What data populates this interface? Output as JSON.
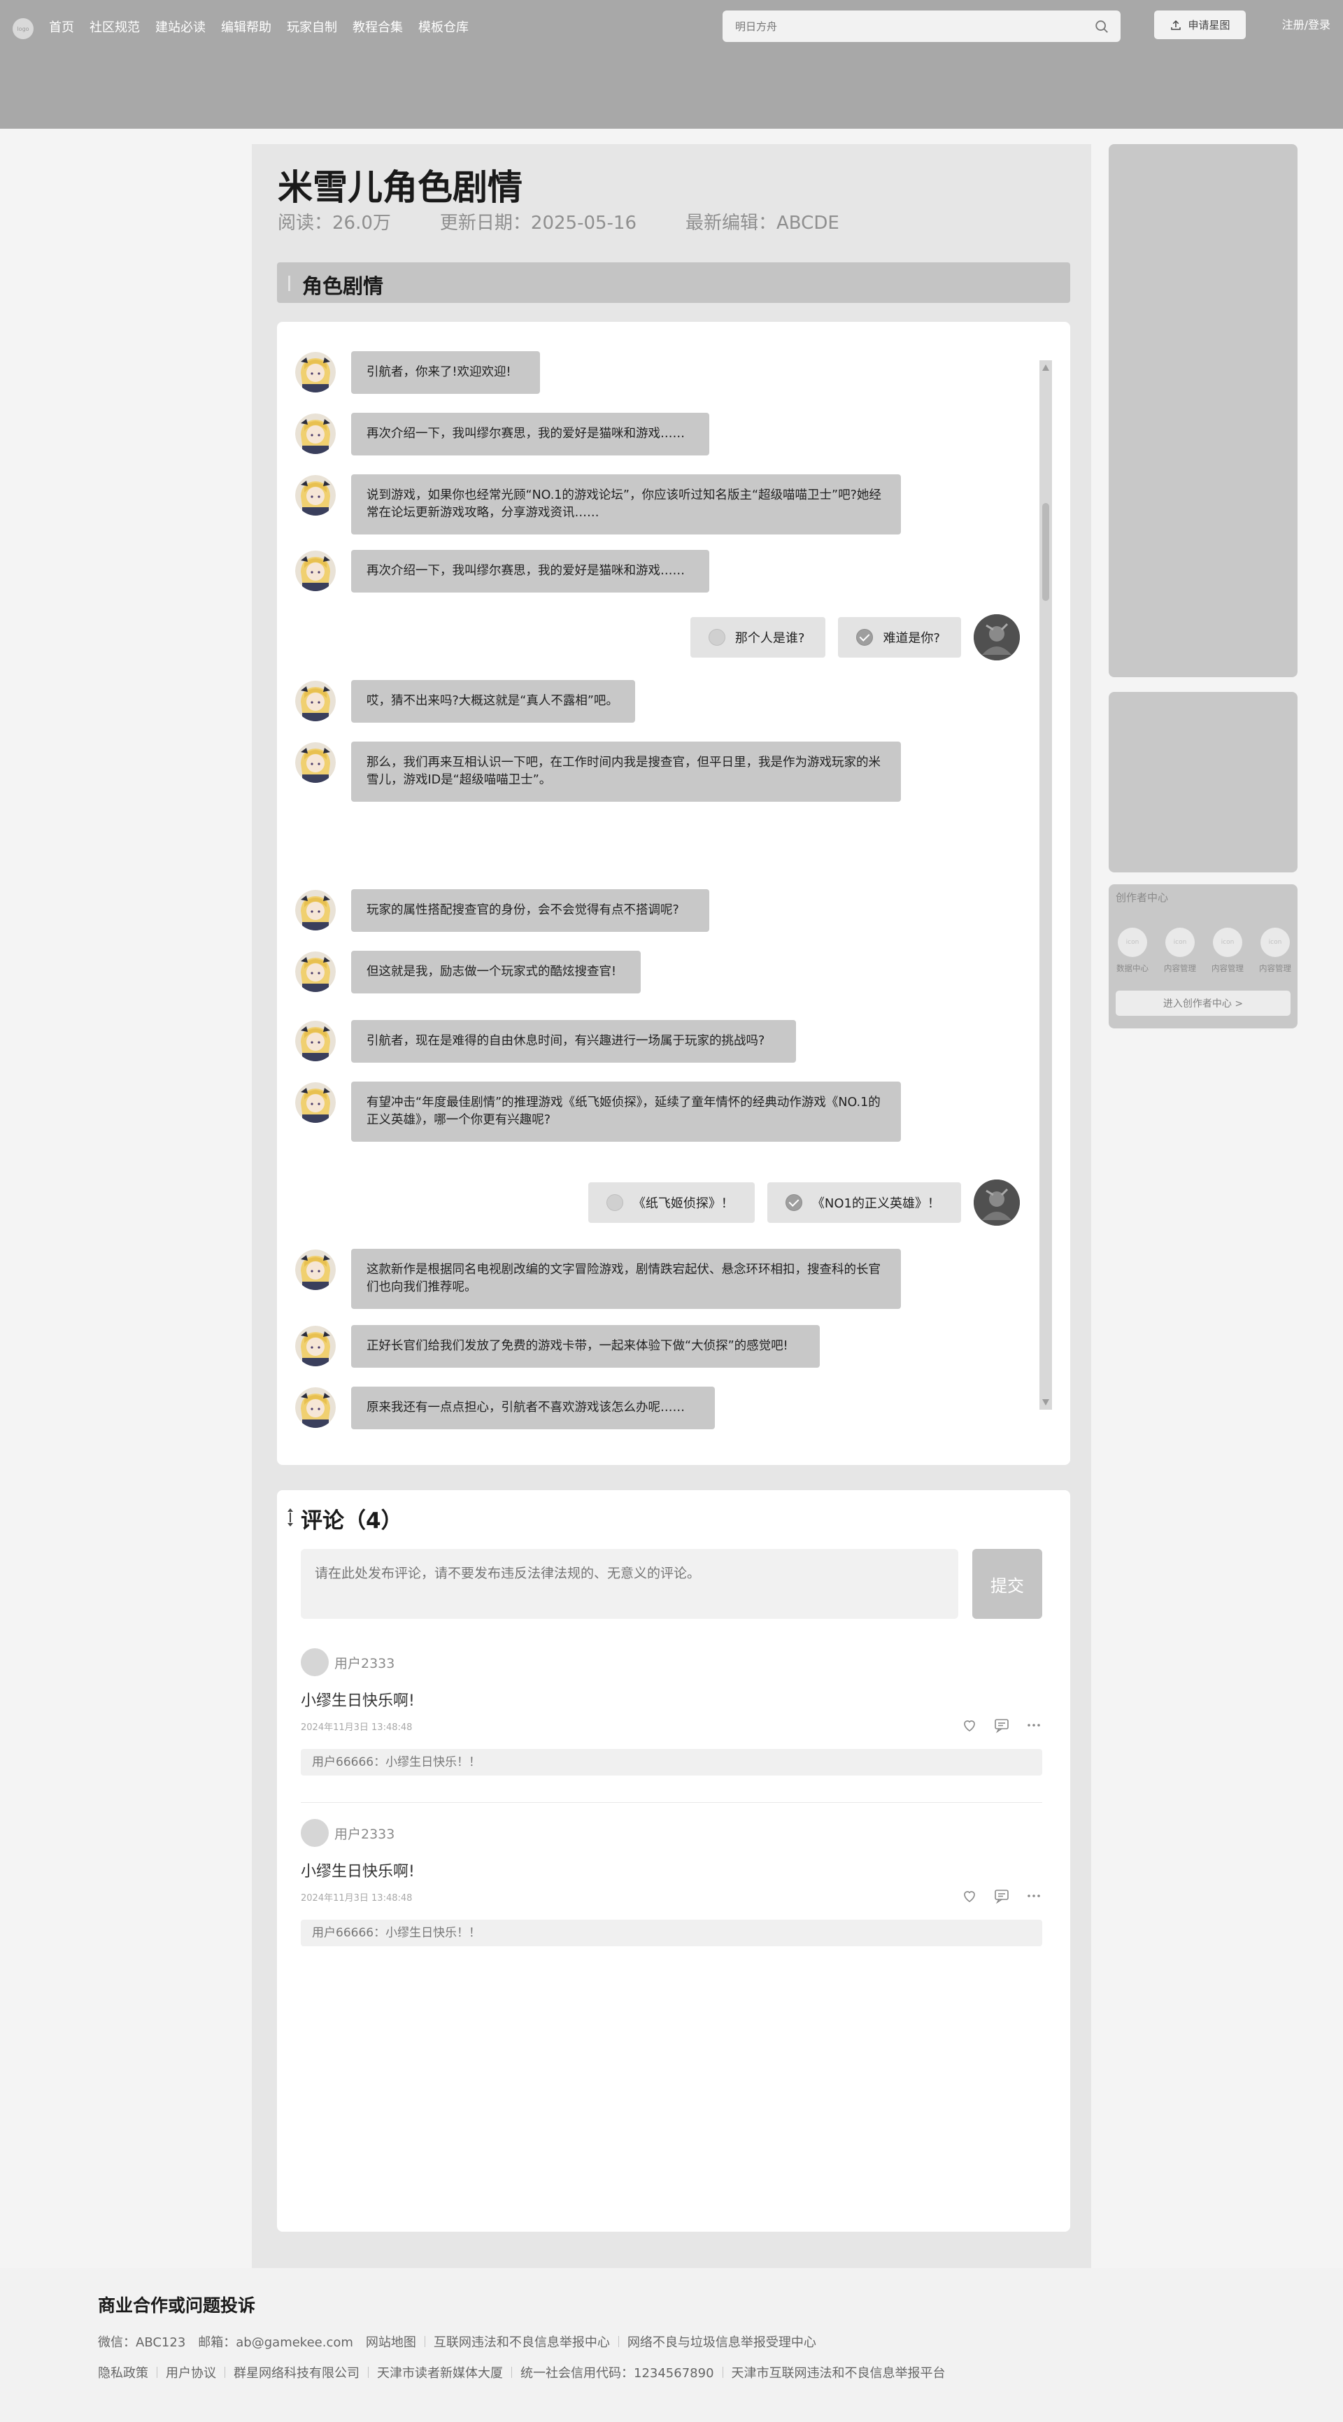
{
  "header": {
    "logo_text": "logo",
    "nav": [
      "首页",
      "社区规范",
      "建站必读",
      "编辑帮助",
      "玩家自制",
      "教程合集",
      "模板仓库"
    ],
    "search_placeholder": "明日方舟",
    "apply_label": "申请星图",
    "login_label": "注册/登录"
  },
  "article": {
    "title": "米雪儿角色剧情",
    "reads": "阅读：26.0万",
    "updated": "更新日期：2025-05-16",
    "editor": "最新编辑：ABCDE",
    "section_title": "角色剧情"
  },
  "chat": {
    "messages": [
      "引航者，你来了!欢迎欢迎!",
      "再次介绍一下，我叫缪尔赛思，我的爱好是猫咪和游戏……",
      "说到游戏，如果你也经常光顾“NO.1的游戏论坛”，你应该听过知名版主“超级喵喵卫士”吧?她经常在论坛更新游戏攻略，分享游戏资讯……",
      "再次介绍一下，我叫缪尔赛思，我的爱好是猫咪和游戏……",
      "哎，猜不出来吗?大概这就是“真人不露相”吧。",
      "那么，我们再来互相认识一下吧，在工作时间内我是搜查官，但平日里，我是作为游戏玩家的米雪儿，游戏ID是“超级喵喵卫士”。",
      "玩家的属性搭配搜查官的身份，会不会觉得有点不搭调呢?",
      "但这就是我，励志做一个玩家式的酷炫搜查官!",
      "引航者，现在是难得的自由休息时间，有兴趣进行一场属于玩家的挑战吗?",
      "有望冲击“年度最佳剧情”的推理游戏《纸飞姬侦探》，延续了童年情怀的经典动作游戏《NO.1的正义英雄》，哪一个你更有兴趣呢?",
      "这款新作是根据同名电视剧改编的文字冒险游戏，剧情跌宕起伏、悬念环环相扣，搜查科的长官们也向我们推荐呢。",
      "正好长官们给我们发放了免费的游戏卡带，一起来体验下做“大侦探”的感觉吧!",
      "原来我还有一点点担心，引航者不喜欢游戏该怎么办呢……"
    ],
    "choices1": [
      "那个人是谁?",
      "难道是你?"
    ],
    "choices2": [
      "《纸飞姬侦探》！",
      "《NO1的正义英雄》！"
    ]
  },
  "comments": {
    "title": "评论（4）",
    "placeholder": "请在此处发布评论，请不要发布违反法律法规的、无意义的评论。",
    "submit": "提交",
    "items": [
      {
        "user": "用户2333",
        "text": "小缪生日快乐啊!",
        "date": "2024年11月3日  13:48:48",
        "reply": "用户66666：小缪生日快乐！！"
      },
      {
        "user": "用户2333",
        "text": "小缪生日快乐啊!",
        "date": "2024年11月3日  13:48:48",
        "reply": "用户66666：小缪生日快乐！！"
      }
    ]
  },
  "sidebar": {
    "creator_title": "创作者中心",
    "icon_text": "icon",
    "creator_items": [
      "数据中心",
      "内容管理",
      "内容管理",
      "内容管理"
    ],
    "creator_button": "进入创作者中心 >"
  },
  "footer": {
    "title": "商业合作或问题投诉",
    "wechat": "微信：ABC123",
    "email": "邮箱：ab@gamekee.com",
    "row1": [
      "网站地图",
      "互联网违法和不良信息举报中心",
      "网络不良与垃圾信息举报受理中心"
    ],
    "row2": [
      "隐私政策",
      "用户协议",
      "群星网络科技有限公司",
      "天津市读者新媒体大厦",
      "统一社会信用代码：1234567890",
      "天津市互联网违法和不良信息举报平台"
    ]
  }
}
